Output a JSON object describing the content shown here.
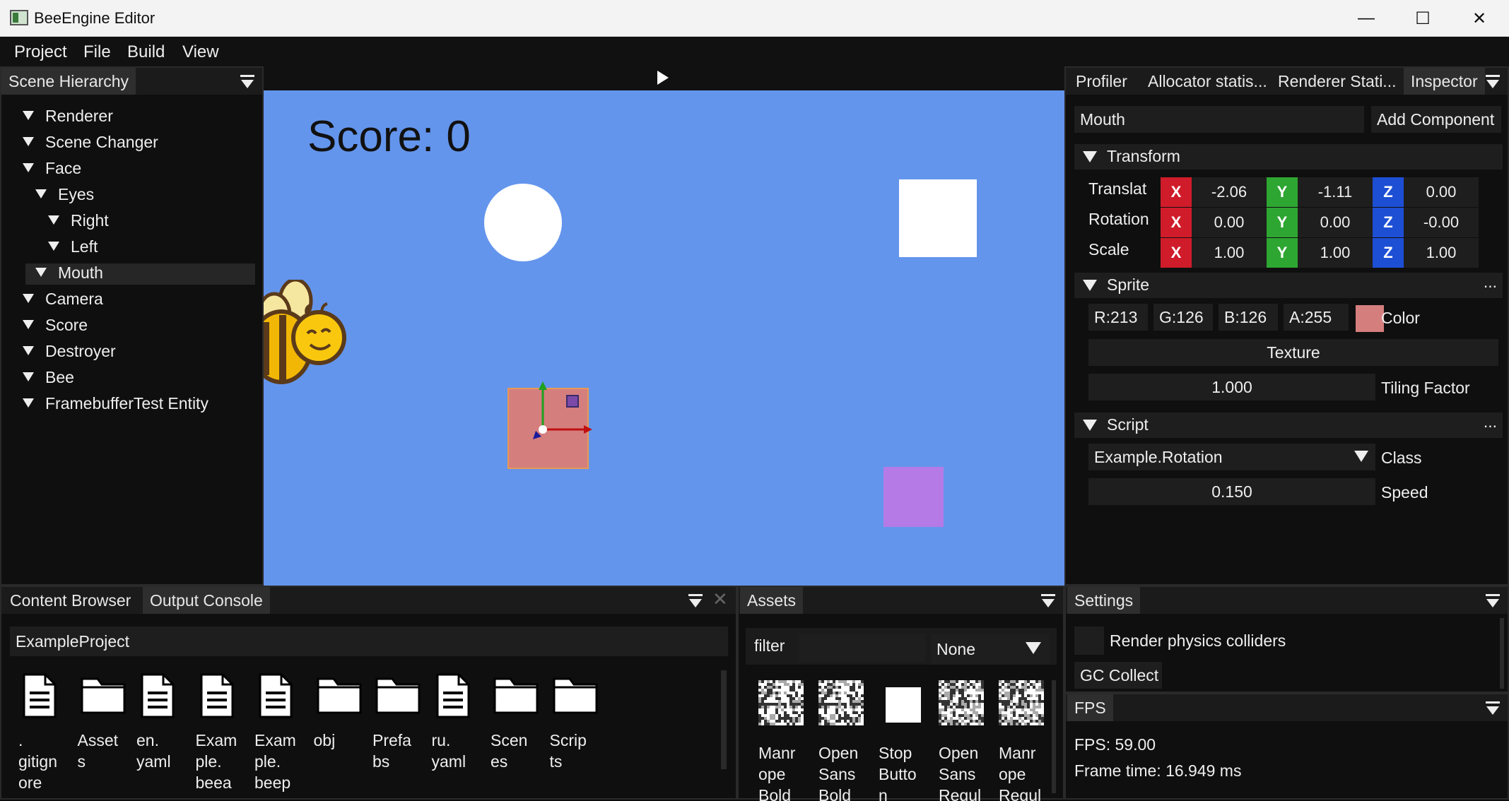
{
  "window": {
    "title": "BeeEngine Editor",
    "minimize": "—",
    "maximize": "☐",
    "close": "✕"
  },
  "menu": [
    "Project",
    "File",
    "Build",
    "View"
  ],
  "hierarchy": {
    "tab": "Scene Hierarchy",
    "items": [
      "Renderer",
      "Scene Changer",
      "Face",
      "Eyes",
      "Right",
      "Left",
      "Mouth",
      "Camera",
      "Score",
      "Destroyer",
      "Bee",
      "FramebufferTest Entity"
    ],
    "selected": "Mouth"
  },
  "viewport": {
    "score_text": "Score: 0"
  },
  "inspector": {
    "tabs": [
      "Profiler",
      "Allocator statis...",
      "Renderer Stati...",
      "Inspector"
    ],
    "entity_name": "Mouth",
    "add_component": "Add Component",
    "transform": {
      "header": "Transform",
      "rows": [
        {
          "label": "Translat",
          "x": "-2.06",
          "y": "-1.11",
          "z": "0.00"
        },
        {
          "label": "Rotation",
          "x": "0.00",
          "y": "0.00",
          "z": "-0.00"
        },
        {
          "label": "Scale",
          "x": "1.00",
          "y": "1.00",
          "z": "1.00"
        }
      ],
      "axis_x": "X",
      "axis_y": "Y",
      "axis_z": "Z"
    },
    "sprite": {
      "header": "Sprite",
      "more": "...",
      "r": "R:213",
      "g": "G:126",
      "b": "B:126",
      "a": "A:255",
      "color_label": "Color",
      "color_hex": "#d57e7e",
      "texture": "Texture",
      "tiling_value": "1.000",
      "tiling_label": "Tiling Factor"
    },
    "script": {
      "header": "Script",
      "more": "...",
      "class_value": "Example.Rotation",
      "class_label": "Class",
      "speed_value": "0.150",
      "speed_label": "Speed"
    }
  },
  "content_browser": {
    "tabs": [
      "Content Browser",
      "Output Console"
    ],
    "path": "ExampleProject",
    "items": [
      {
        "name": ".gitignore",
        "label_lines": [
          ".",
          "gitign",
          "ore"
        ],
        "icon": "file-icon"
      },
      {
        "name": "Assets",
        "label_lines": [
          "Asset",
          "s"
        ],
        "icon": "folder-icon"
      },
      {
        "name": "en.yaml",
        "label_lines": [
          "en.",
          "yaml"
        ],
        "icon": "file-icon"
      },
      {
        "name": "Example.beea",
        "label_lines": [
          "Exam",
          "ple.",
          "beea"
        ],
        "icon": "file-icon"
      },
      {
        "name": "Example.beep",
        "label_lines": [
          "Exam",
          "ple.",
          "beep"
        ],
        "icon": "file-icon"
      },
      {
        "name": "obj",
        "label_lines": [
          "obj"
        ],
        "icon": "folder-icon"
      },
      {
        "name": "Prefabs",
        "label_lines": [
          "Prefa",
          "bs"
        ],
        "icon": "folder-icon"
      },
      {
        "name": "ru.yaml",
        "label_lines": [
          "ru.",
          "yaml"
        ],
        "icon": "file-icon"
      },
      {
        "name": "Scenes",
        "label_lines": [
          "Scen",
          "es"
        ],
        "icon": "folder-icon"
      },
      {
        "name": "Scripts",
        "label_lines": [
          "Scrip",
          "ts"
        ],
        "icon": "folder-icon"
      }
    ]
  },
  "assets": {
    "tab": "Assets",
    "filter_label": "filter",
    "filter_value": "",
    "type_select": "None",
    "items": [
      {
        "label_lines": [
          "Manr",
          "ope",
          "Bold"
        ],
        "kind": "noise"
      },
      {
        "label_lines": [
          "Open",
          "Sans",
          "Bold"
        ],
        "kind": "noise"
      },
      {
        "label_lines": [
          "Stop",
          "Butto",
          "n"
        ],
        "kind": "white"
      },
      {
        "label_lines": [
          "Open",
          "Sans",
          "Regul"
        ],
        "kind": "noise-dark"
      },
      {
        "label_lines": [
          "Manr",
          "ope",
          "Regul"
        ],
        "kind": "noise-dark"
      }
    ]
  },
  "settings": {
    "tab": "Settings",
    "render_colliders": "Render physics colliders",
    "gc_collect": "GC Collect"
  },
  "fps": {
    "tab": "FPS",
    "fps_text": "FPS: 59.00",
    "frame_time_text": "Frame time: 16.949 ms"
  }
}
